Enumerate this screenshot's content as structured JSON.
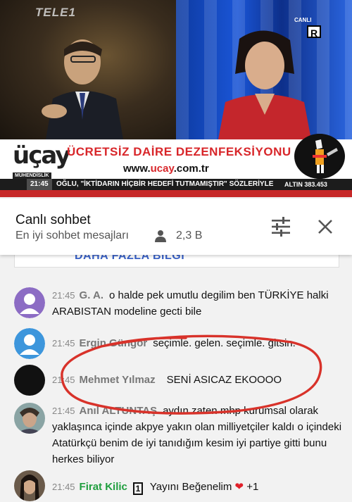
{
  "video": {
    "channel_logo": "TELE1",
    "live_tag": "CANLI",
    "rating_badge": "R",
    "banner": {
      "brand": "üçay",
      "brand_sub": "MÜHENDİSLİK",
      "title": "ÜCRETSİZ DAİRE DEZENFEKSİYONU",
      "url_prefix": "www.",
      "url_brand": "ucay",
      "url_suffix": ".com.tr"
    },
    "ticker": {
      "time": "21:45",
      "text": "OĞLU, \"İKTİDARIN HİÇBİR HEDEFİ TUTMAMIŞTIR\" SÖZLERİYLE",
      "gold": "ALTIN 383.453"
    }
  },
  "chat_header": {
    "title": "Canlı sohbet",
    "subtitle": "En iyi sohbet mesajları",
    "viewer_count": "2,3 B"
  },
  "info_card": {
    "link": "DAHA FAZLA BİLGİ"
  },
  "messages": [
    {
      "time": "21:45",
      "author": "G. A.",
      "text": "o halde pek umutlu degilim ben TÜRKİYE halki ARABISTAN modeline gecti bile",
      "avatar_color": "#8c6cc4"
    },
    {
      "time": "21:45",
      "author": "Ergin Güngör",
      "text": "seçimle. gelen. seçimle. gitsin.",
      "avatar_color": "#3d96dc"
    },
    {
      "time": "21:45",
      "author": "Mehmet Yılmaz",
      "text": "SENİ ASICAZ EKOOOO",
      "avatar_color": "#111111"
    },
    {
      "time": "21:45",
      "author": "Anıl ALTUNTAŞ",
      "text": "aydın zaten mhp kurumsal olarak yaklaşınca içinde akpye yakın olan milliyetçiler kaldı o içindeki Atatürkçü benim de iyi tanıdığım kesim iyi partiye gitti bunu herkes biliyor",
      "avatar_color": "#6a8a8a"
    },
    {
      "time": "21:45",
      "author": "Firat Kilic",
      "badge": "1",
      "text": "Yayını Beğenelim",
      "suffix": "+1",
      "avatar_color": "#5a4a3a"
    }
  ],
  "icons": {
    "viewer": "person-icon",
    "filter": "sliders-icon",
    "close": "close-icon",
    "heart": "heart-icon"
  },
  "colors": {
    "accent_red": "#d8262a",
    "link_blue": "#3a62c7",
    "member_green": "#1f9e3e",
    "annotation_red": "#d8322a"
  }
}
